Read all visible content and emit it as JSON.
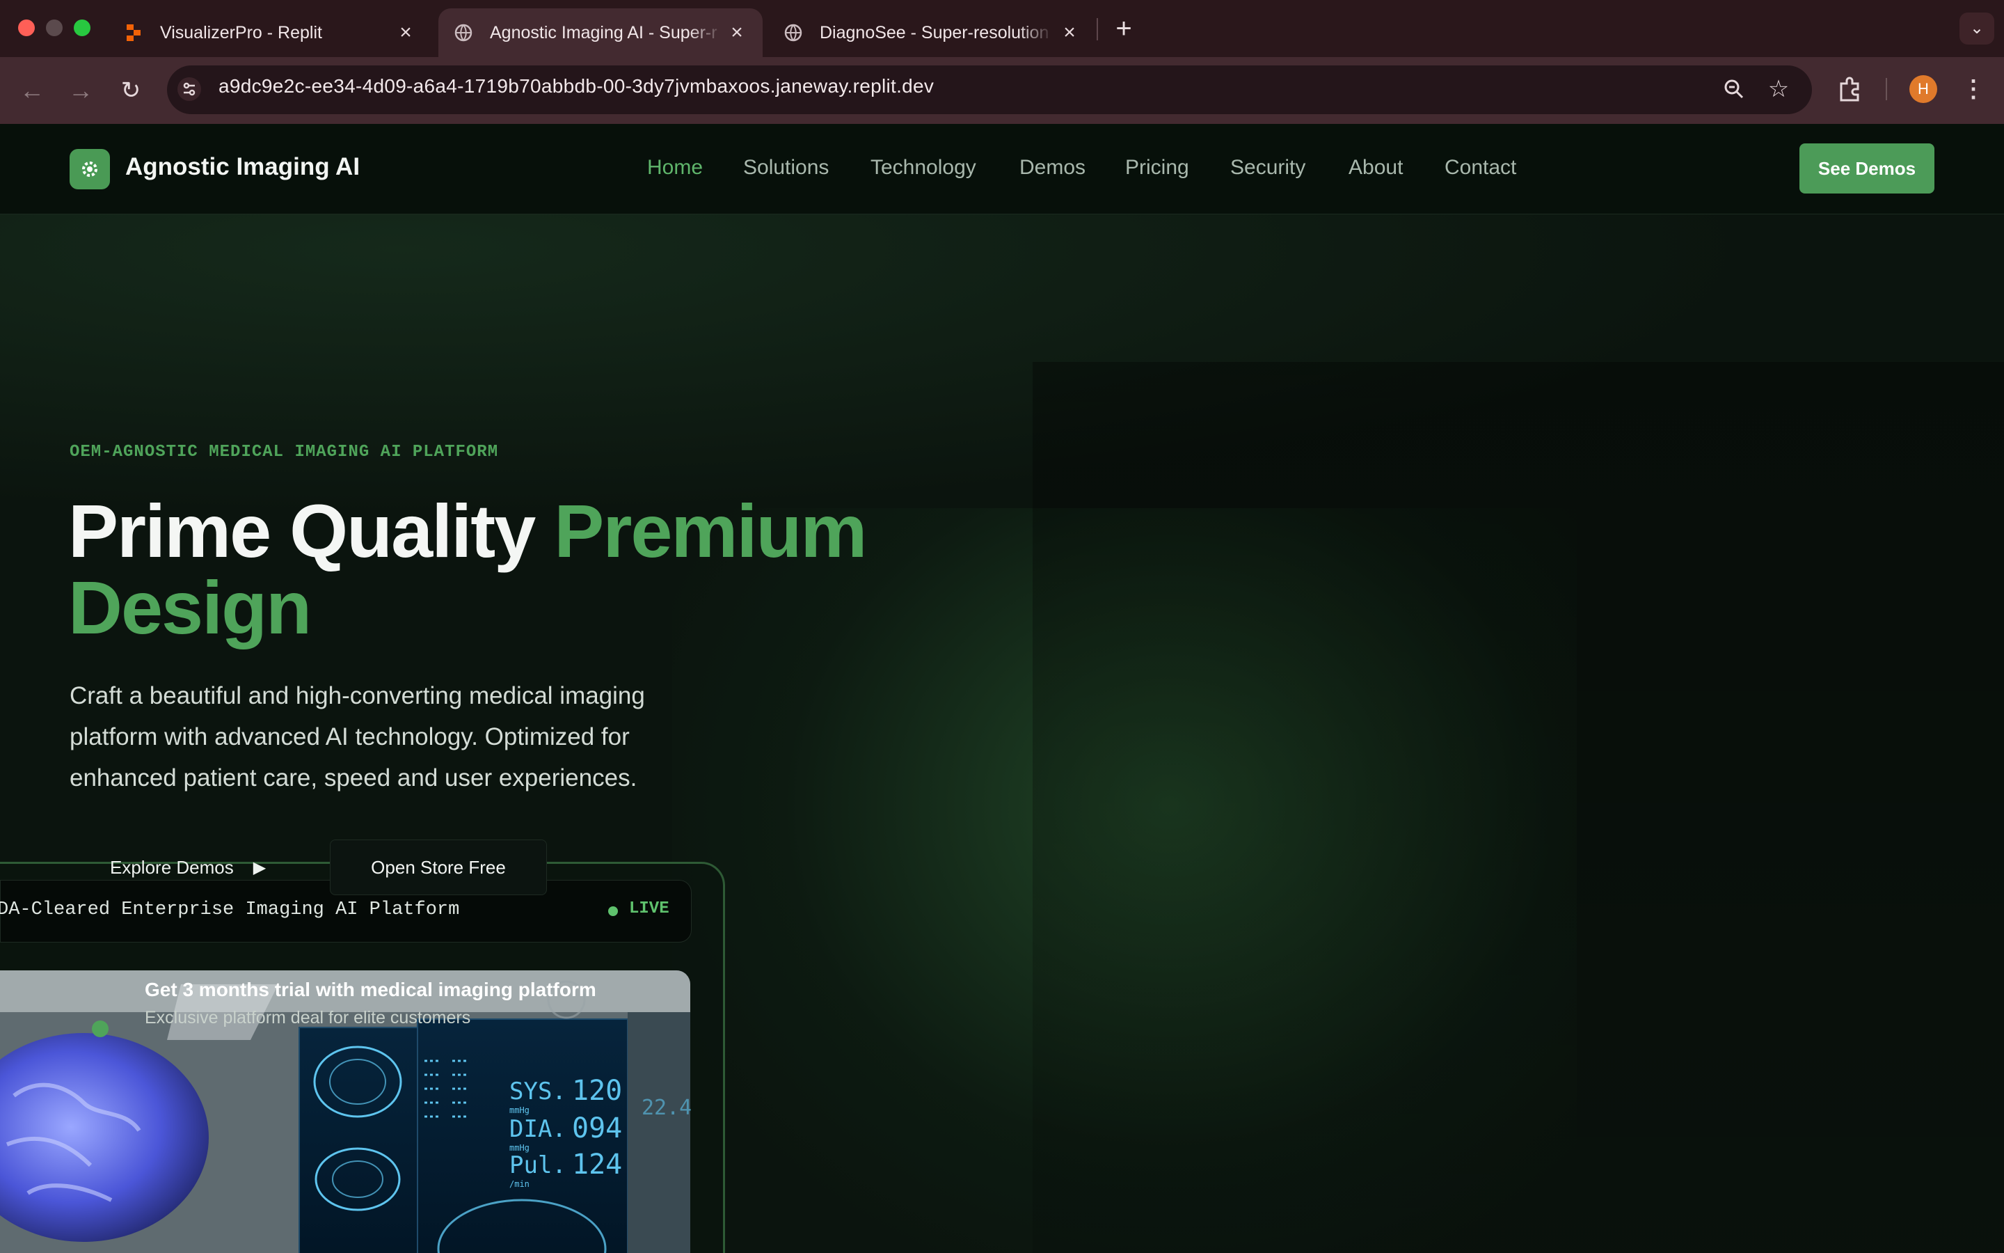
{
  "browser": {
    "tabs": [
      {
        "title": "VisualizerPro - Replit",
        "favicon": "replit-icon"
      },
      {
        "title": "Agnostic Imaging AI - Super-r",
        "favicon": "globe-icon"
      },
      {
        "title": "DiagnoSee - Super-resolution",
        "favicon": "globe-icon"
      }
    ],
    "url": "a9dc9e2c-ee34-4d09-a6a4-1719b70abbdb-00-3dy7jvmbaxoos.janeway.replit.dev",
    "profile_initial": "H",
    "colors": {
      "tab_bar": "#2a171b",
      "toolbar": "#432a30",
      "profile": "#e07a2b"
    }
  },
  "site": {
    "brand": "Agnostic Imaging AI",
    "nav": [
      "Home",
      "Solutions",
      "Technology",
      "Demos",
      "Pricing",
      "Security",
      "About",
      "Contact"
    ],
    "active_nav": "Home",
    "cta": "See Demos",
    "colors": {
      "accent": "#4fa45a",
      "nav_bg": "#07100a",
      "page_bg": "#0b140e"
    }
  },
  "hero": {
    "eyebrow": "OEM-AGNOSTIC MEDICAL IMAGING AI PLATFORM",
    "title_part1": "Prime Quality",
    "title_part2": "Premium",
    "title_part3": "Design",
    "lead": "Craft a beautiful and high-converting medical imaging platform with advanced AI technology. Optimized for enhanced patient care, speed and user experiences.",
    "explore_label": "Explore Demos",
    "open_store_label": "Open Store Free"
  },
  "showcase": {
    "banner_text": "DA-Cleared Enterprise Imaging AI Platform",
    "live_label": "LIVE",
    "promo_title": "Get 3 months trial with medical imaging platform",
    "promo_subtitle": "Exclusive platform deal for elite customers",
    "vitals": {
      "sys_label": "SYS.",
      "sys_value": "120",
      "sys_unit": "mmHg",
      "dia_label": "DIA.",
      "dia_value": "094",
      "dia_unit": "mmHg",
      "pul_label": "Pul.",
      "pul_value": "124",
      "pul_unit": "/min",
      "side_value": "22.4"
    }
  }
}
